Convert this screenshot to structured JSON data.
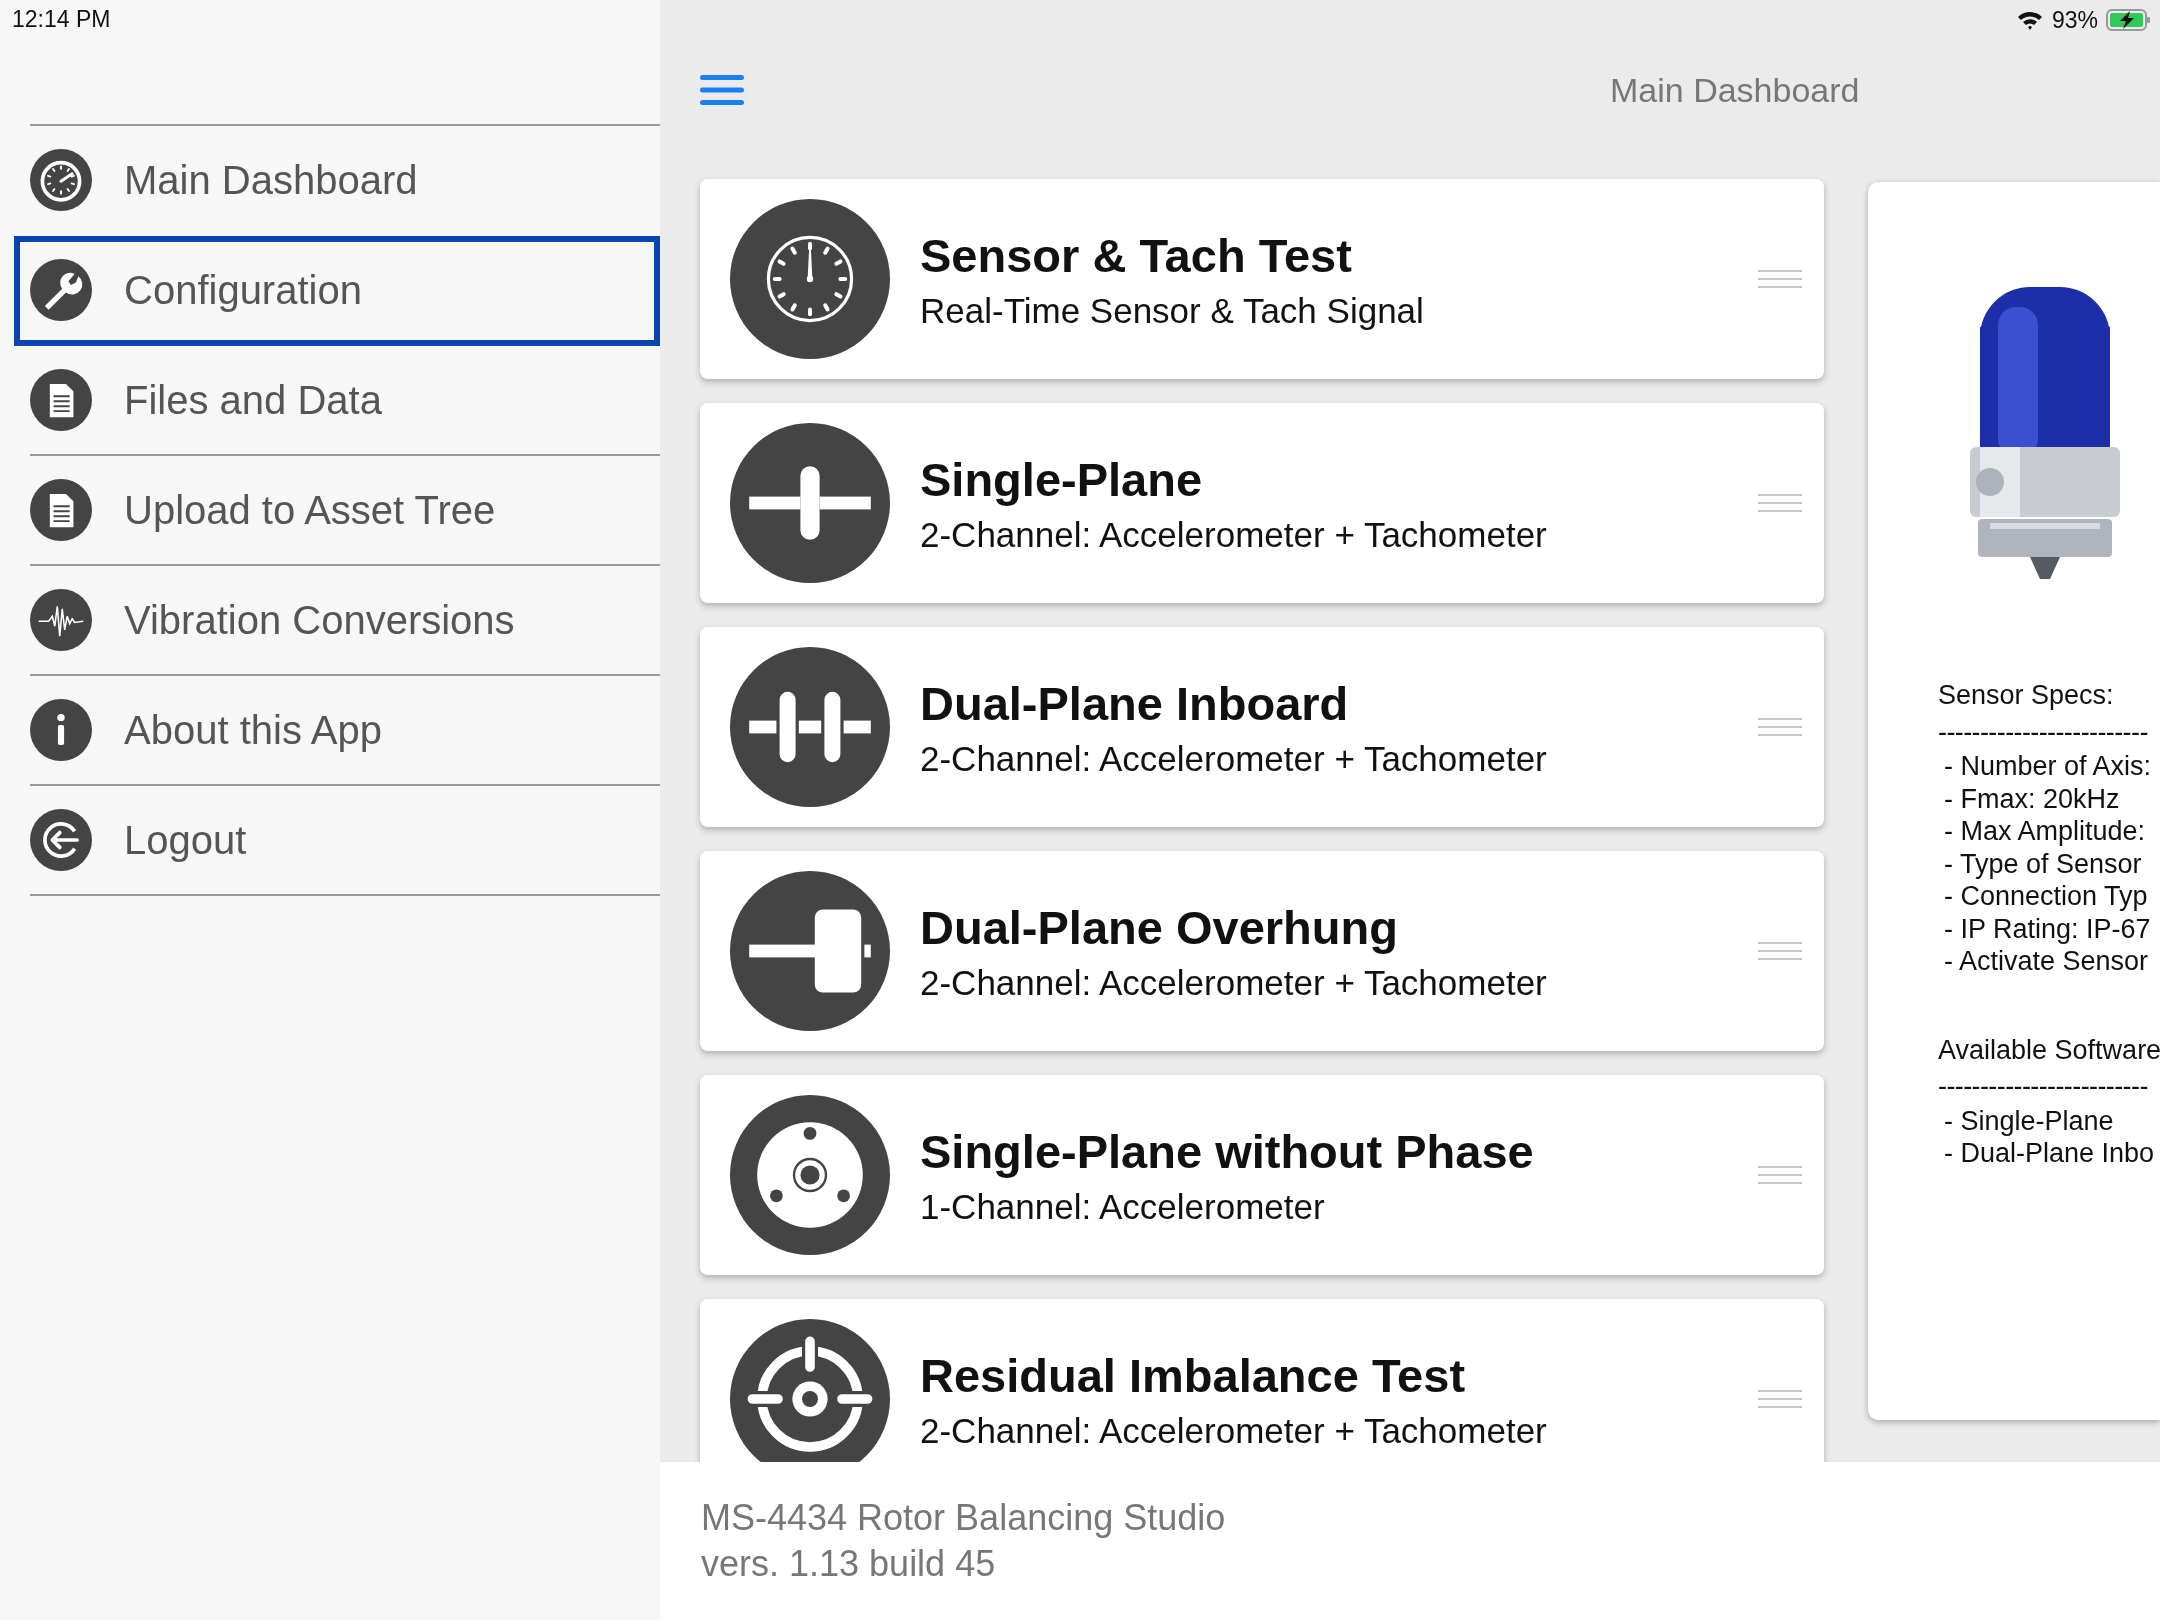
{
  "status_bar": {
    "time": "12:14 PM",
    "battery": "93%"
  },
  "sidebar": {
    "items": [
      {
        "label": "Main Dashboard",
        "kind": "gauge",
        "selected": false
      },
      {
        "label": "Configuration",
        "kind": "wrench",
        "selected": true
      },
      {
        "label": "Files and Data",
        "kind": "file",
        "selected": false
      },
      {
        "label": "Upload to Asset Tree",
        "kind": "file",
        "selected": false
      },
      {
        "label": "Vibration Conversions",
        "kind": "wave",
        "selected": false
      },
      {
        "label": "About this App",
        "kind": "info",
        "selected": false
      },
      {
        "label": "Logout",
        "kind": "logout",
        "selected": false
      }
    ]
  },
  "header": {
    "title": "Main Dashboard"
  },
  "cards": [
    {
      "title": "Sensor & Tach Test",
      "subtitle": "Real-Time Sensor & Tach Signal",
      "kind": "gauge"
    },
    {
      "title": "Single-Plane",
      "subtitle": "2-Channel: Accelerometer + Tachometer",
      "kind": "single"
    },
    {
      "title": "Dual-Plane Inboard",
      "subtitle": "2-Channel: Accelerometer + Tachometer",
      "kind": "dual"
    },
    {
      "title": "Dual-Plane Overhung",
      "subtitle": "2-Channel: Accelerometer + Tachometer",
      "kind": "overhung"
    },
    {
      "title": "Single-Plane without Phase",
      "subtitle": "1-Channel: Accelerometer",
      "kind": "wheel"
    },
    {
      "title": "Residual Imbalance Test",
      "subtitle": "2-Channel: Accelerometer + Tachometer",
      "kind": "target"
    }
  ],
  "sensor_panel": {
    "sections": [
      {
        "heading": "Sensor Specs:",
        "rule": "-------------------------",
        "lines": [
          "- Number of Axis:",
          "- Fmax: 20kHz",
          "- Max Amplitude:",
          "- Type of Sensor",
          "- Connection Typ",
          "- IP Rating: IP-67",
          "- Activate Sensor"
        ]
      },
      {
        "heading": "Available Software",
        "rule": "-------------------------",
        "lines": [
          "- Single-Plane",
          "- Dual-Plane Inbo"
        ]
      }
    ]
  },
  "footer": {
    "lines": [
      "MS-4434 Rotor Balancing Studio",
      "vers. 1.13 build 45"
    ]
  }
}
